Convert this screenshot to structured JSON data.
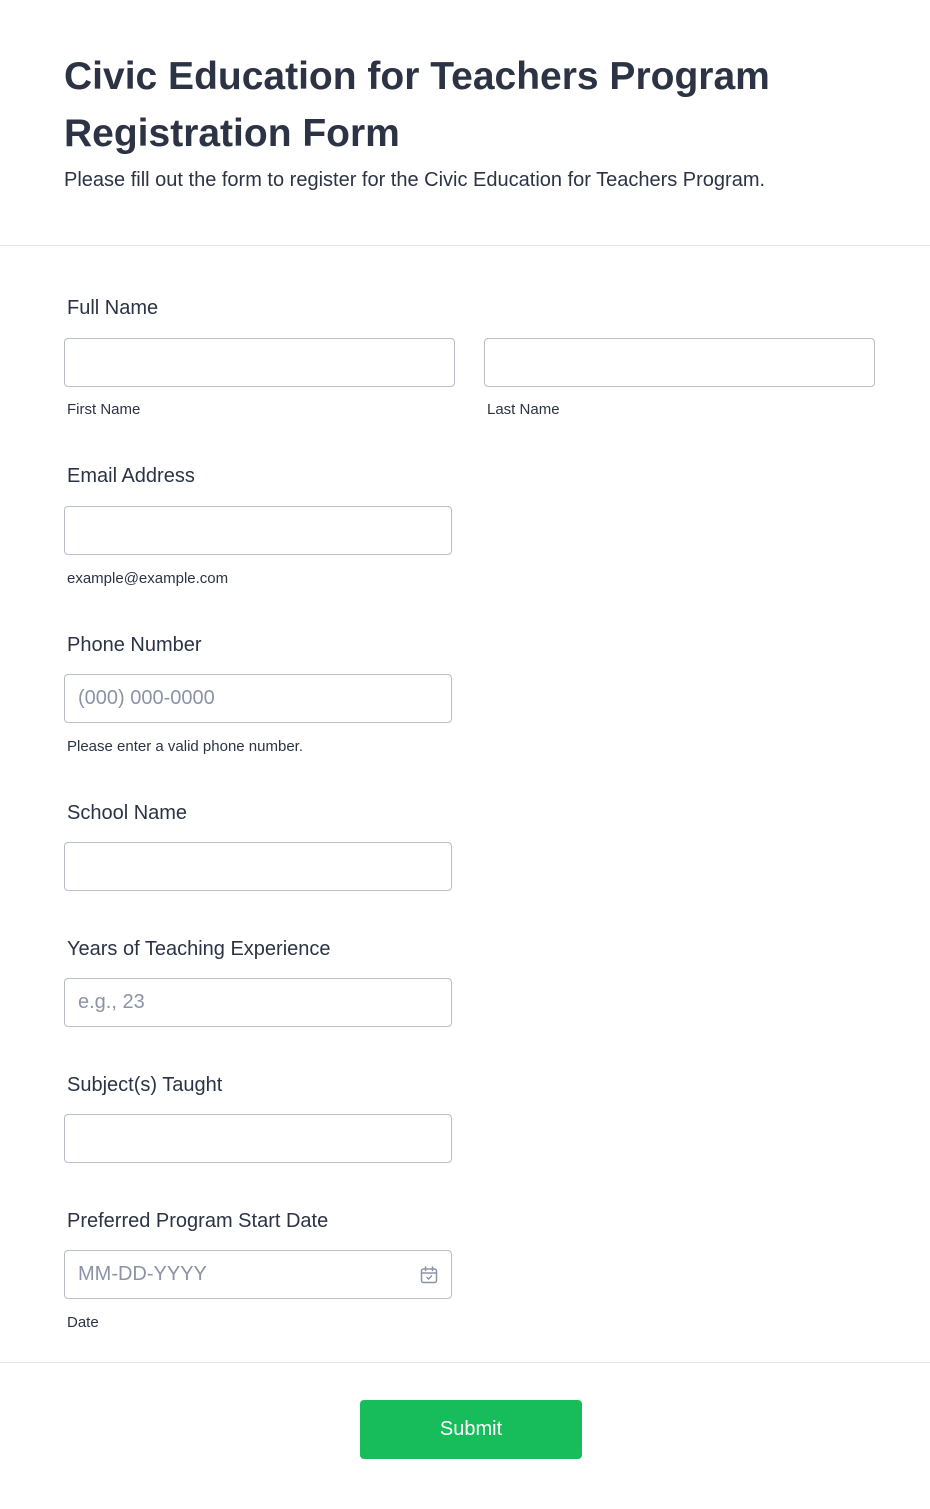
{
  "header": {
    "title": "Civic Education for Teachers Program Registration Form",
    "subtitle": "Please fill out the form to register for the Civic Education for Teachers Program."
  },
  "fields": {
    "full_name": {
      "label": "Full Name",
      "first_sublabel": "First Name",
      "last_sublabel": "Last Name",
      "first_value": "",
      "last_value": ""
    },
    "email": {
      "label": "Email Address",
      "sublabel": "example@example.com",
      "value": ""
    },
    "phone": {
      "label": "Phone Number",
      "placeholder": "(000) 000-0000",
      "sublabel": "Please enter a valid phone number.",
      "value": ""
    },
    "school": {
      "label": "School Name",
      "value": ""
    },
    "experience": {
      "label": "Years of Teaching Experience",
      "placeholder": "e.g., 23",
      "value": ""
    },
    "subjects": {
      "label": "Subject(s) Taught",
      "value": ""
    },
    "start_date": {
      "label": "Preferred Program Start Date",
      "placeholder": "MM-DD-YYYY",
      "sublabel": "Date",
      "icon": "calendar-icon",
      "value": ""
    }
  },
  "submit": {
    "label": "Submit"
  },
  "colors": {
    "accent": "#18bd5b",
    "text": "#2c3345",
    "border": "#b8bdc9",
    "placeholder": "#8d93a6"
  }
}
